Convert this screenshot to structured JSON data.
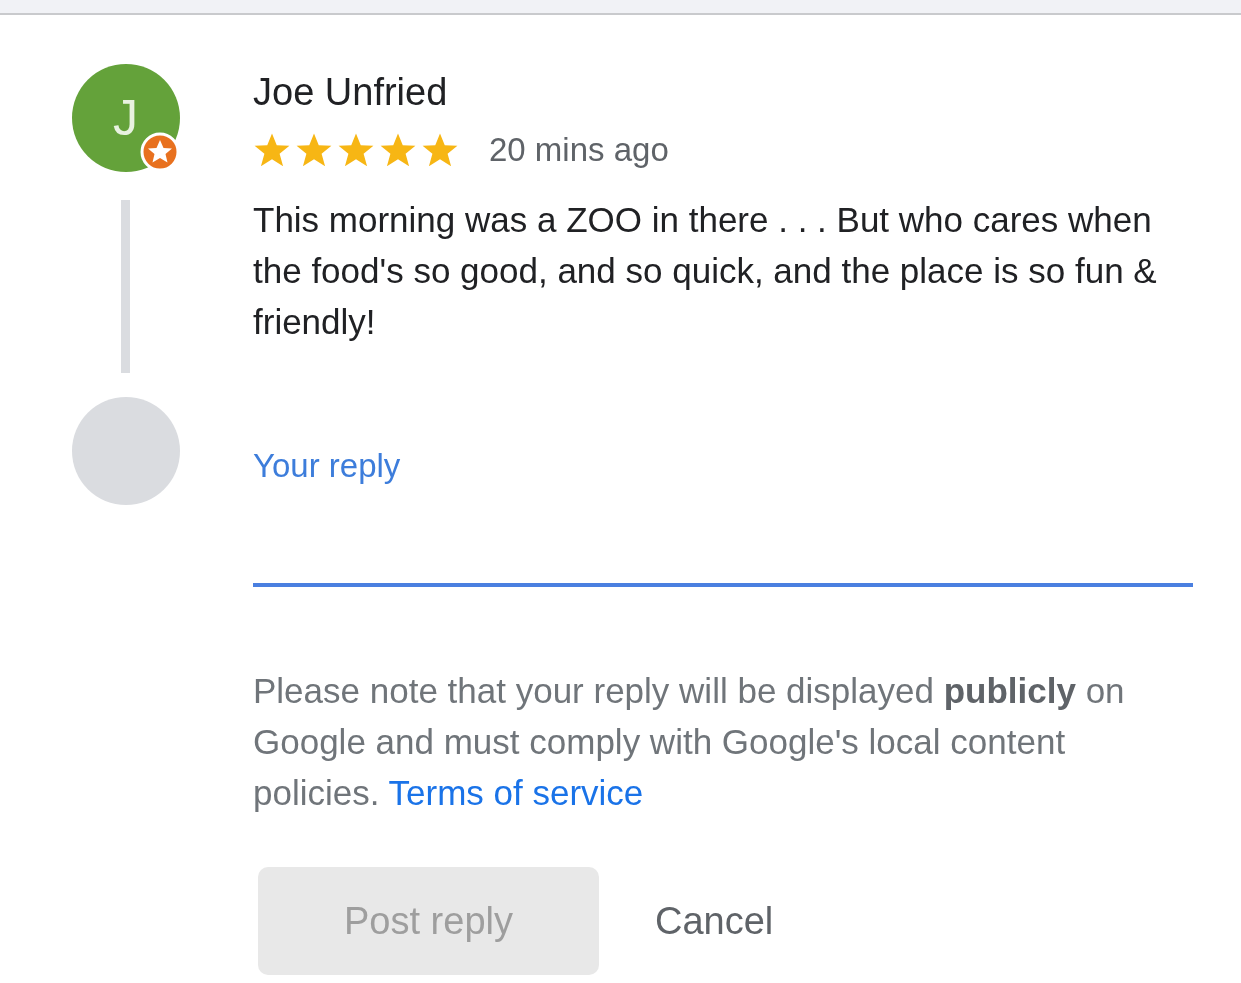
{
  "review": {
    "author": "Joe Unfried",
    "initial": "J",
    "local_guide": true,
    "stars": 5,
    "time": "20 mins ago",
    "text": "This morning was a ZOO in there . . . But who cares when the food's so good, and so quick, and the place is so fun & friendly!"
  },
  "reply": {
    "placeholder": "Your reply"
  },
  "notice": {
    "text": "Please note that your reply will be displayed **publicly** on Google and must comply with Google's local content policies.",
    "link": "Terms of service"
  },
  "buttons": [
    {
      "label": "Post reply",
      "kind": "primary",
      "disabled": true
    },
    {
      "label": "Cancel",
      "kind": "text",
      "disabled": false
    }
  ]
}
